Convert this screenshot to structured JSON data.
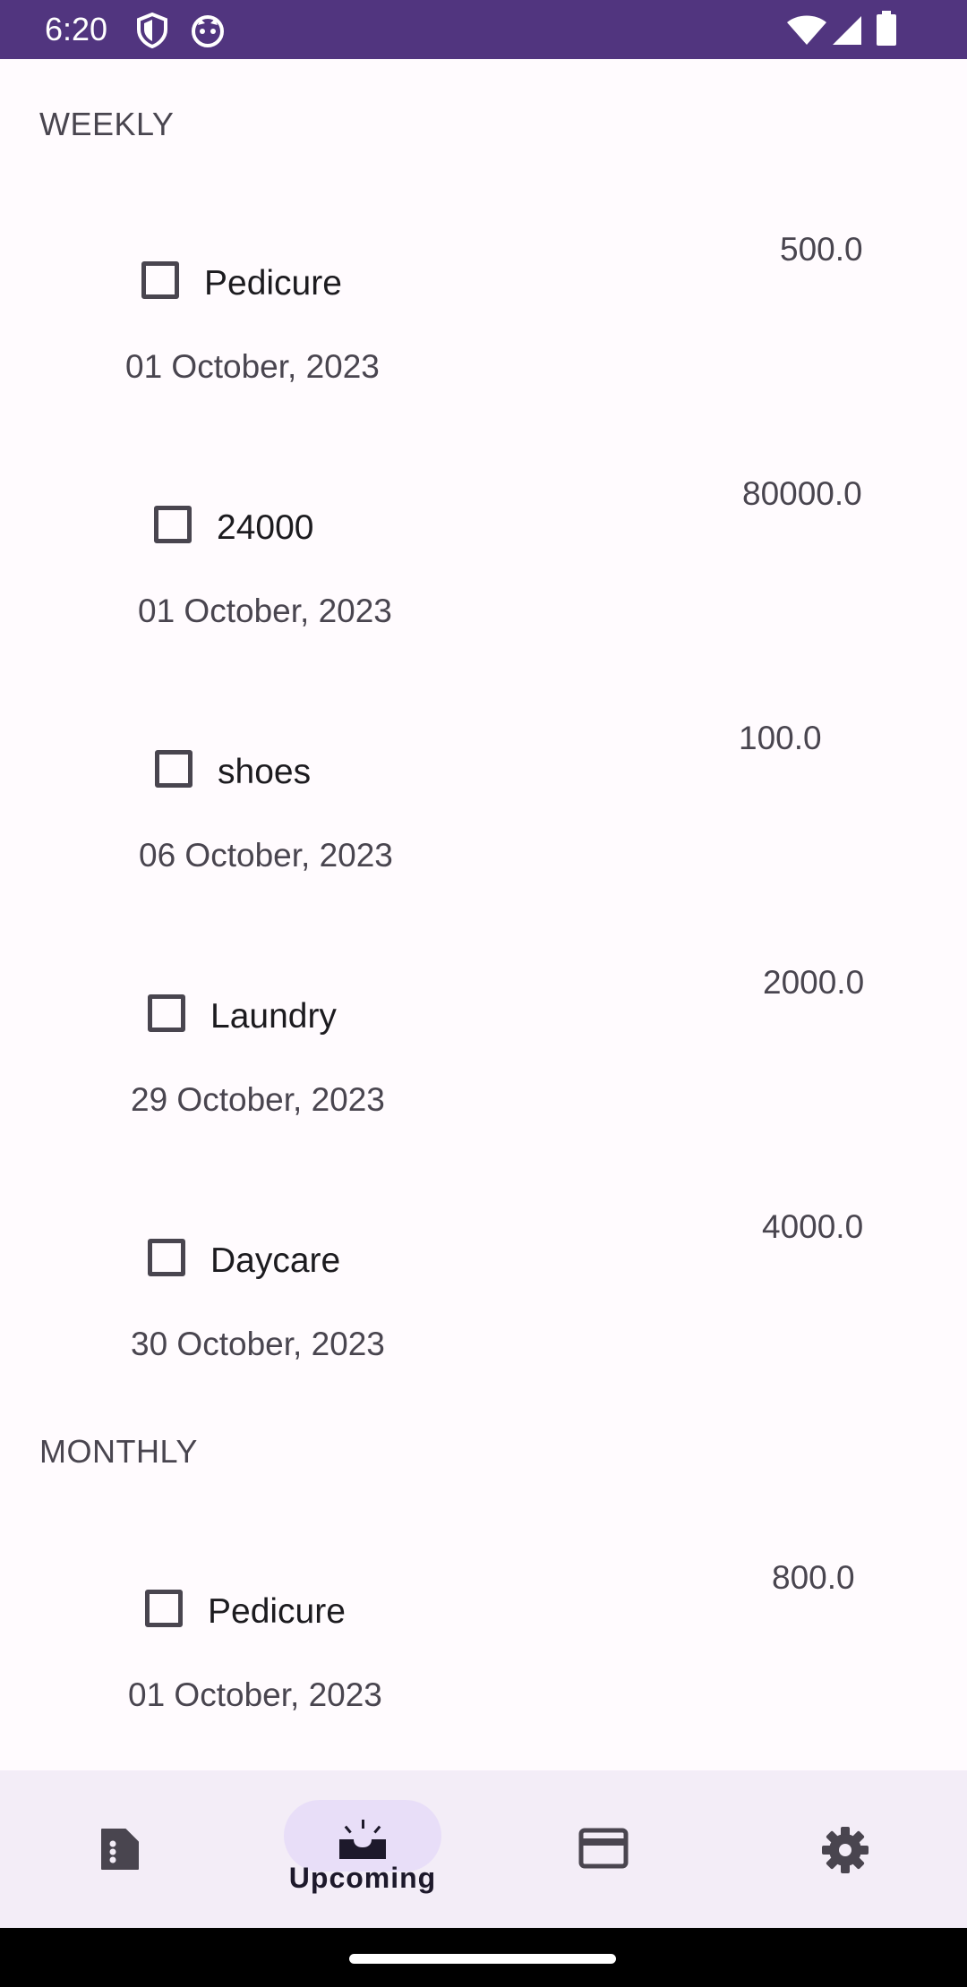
{
  "status_bar": {
    "time": "6:20",
    "icons_left": [
      "shield-icon",
      "cat-icon"
    ],
    "icons_right": [
      "wifi-icon",
      "signal-icon",
      "battery-icon"
    ],
    "color": "#51357f"
  },
  "sections": [
    {
      "header": "WEEKLY",
      "items": [
        {
          "title": "Pedicure",
          "date": "01 October, 2023",
          "amount": "500.0",
          "checked": false
        },
        {
          "title": "24000",
          "date": "01 October, 2023",
          "amount": "80000.0",
          "checked": false
        },
        {
          "title": "shoes",
          "date": "06 October, 2023",
          "amount": "100.0",
          "checked": false
        },
        {
          "title": "Laundry",
          "date": "29 October, 2023",
          "amount": "2000.0",
          "checked": false
        },
        {
          "title": "Daycare",
          "date": "30 October, 2023",
          "amount": "4000.0",
          "checked": false
        }
      ]
    },
    {
      "header": "MONTHLY",
      "items": [
        {
          "title": "Pedicure",
          "date": "01 October, 2023",
          "amount": "800.0",
          "checked": false
        }
      ]
    }
  ],
  "bottom_nav": {
    "items": [
      {
        "icon": "document-icon",
        "label": "",
        "selected": false
      },
      {
        "icon": "upcoming-inbox-icon",
        "label": "Upcoming",
        "selected": true
      },
      {
        "icon": "credit-card-icon",
        "label": "",
        "selected": false
      },
      {
        "icon": "gear-icon",
        "label": "",
        "selected": false
      }
    ],
    "background": "#f3edf7",
    "selected_pill": "#e8def8"
  }
}
